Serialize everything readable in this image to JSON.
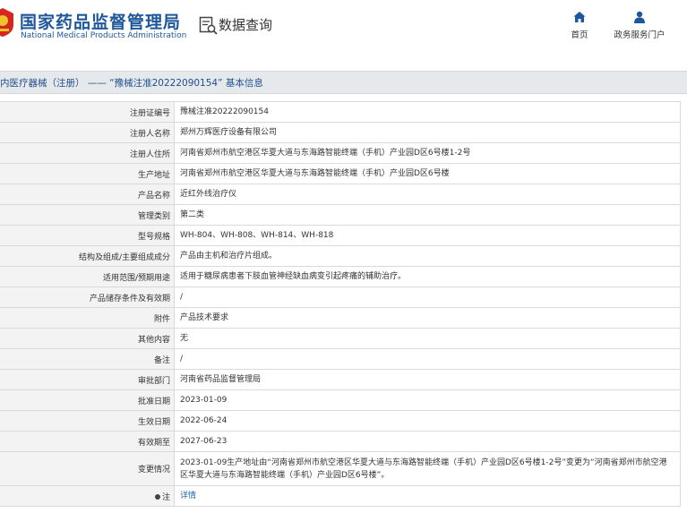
{
  "header": {
    "brand_cn": "国家药品监督管理局",
    "brand_en": "National Medical Products Administration",
    "query_label": "数据查询",
    "nav": {
      "home": "首页",
      "portal": "政务服务门户"
    }
  },
  "titlebar": {
    "text": "内医疗器械（注册） —— “豫械注准20222090154” 基本信息"
  },
  "rows": [
    {
      "label": "注册证编号",
      "value": "豫械注准20222090154"
    },
    {
      "label": "注册人名称",
      "value": "郑州万辉医疗设备有限公司"
    },
    {
      "label": "注册人住所",
      "value": "河南省郑州市航空港区华夏大道与东海路智能终端（手机）产业园D区6号楼1-2号"
    },
    {
      "label": "生产地址",
      "value": "河南省郑州市航空港区华夏大道与东海路智能终端（手机）产业园D区6号楼"
    },
    {
      "label": "产品名称",
      "value": "近红外线治疗仪"
    },
    {
      "label": "管理类别",
      "value": "第二类"
    },
    {
      "label": "型号规格",
      "value": "WH-804、WH-808、WH-814、WH-818"
    },
    {
      "label": "结构及组成/主要组成成分",
      "value": "产品由主机和治疗片组成。"
    },
    {
      "label": "适用范围/预期用途",
      "value": "适用于糖尿病患者下肢血管神经缺血病变引起疼痛的辅助治疗。"
    },
    {
      "label": "产品储存条件及有效期",
      "value": "/"
    },
    {
      "label": "附件",
      "value": "产品技术要求"
    },
    {
      "label": "其他内容",
      "value": "无"
    },
    {
      "label": "备注",
      "value": "/"
    },
    {
      "label": "审批部门",
      "value": "河南省药品监督管理局"
    },
    {
      "label": "批准日期",
      "value": "2023-01-09"
    },
    {
      "label": "生效日期",
      "value": "2022-06-24"
    },
    {
      "label": "有效期至",
      "value": "2027-06-23"
    },
    {
      "label": "变更情况",
      "value": "2023-01-09生产地址由“河南省郑州市航空港区华夏大道与东海路智能终端（手机）产业园D区6号楼1-2号”变更为“河南省郑州市航空港区华夏大道与东海路智能终端（手机）产业园D区6号楼”。"
    }
  ],
  "note_row": {
    "label": "注",
    "link": "详情"
  },
  "colors": {
    "brand_blue": "#1e5799",
    "title_bar_bg": "#e6e9ec",
    "label_bg": "#f3f3f3",
    "link_blue": "#1e64b4",
    "emblem_red": "#d7261e",
    "emblem_gold": "#f2c12e"
  }
}
